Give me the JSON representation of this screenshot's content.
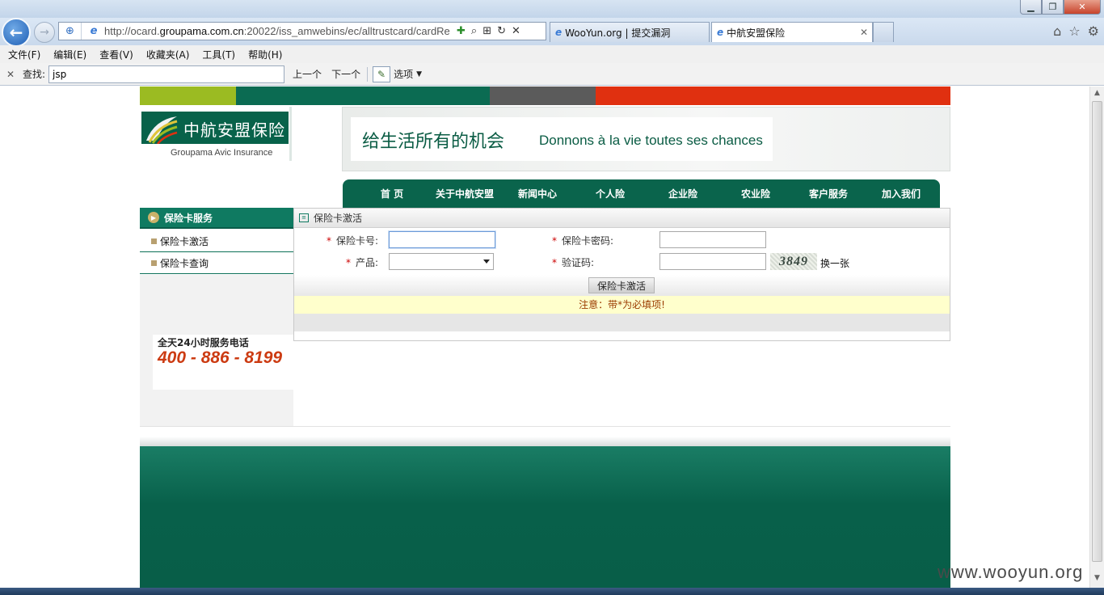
{
  "browser": {
    "url_prefix": "http://ocard.",
    "url_domain": "groupama.com.cn",
    "url_rest": ":20022/iss_amwebins/ec/alltrustcard/cardRe",
    "tabs": [
      {
        "label": "WooYun.org | 提交漏洞"
      },
      {
        "label": "中航安盟保险"
      }
    ],
    "menu": [
      "文件(F)",
      "编辑(E)",
      "查看(V)",
      "收藏夹(A)",
      "工具(T)",
      "帮助(H)"
    ],
    "find": {
      "label": "查找:",
      "value": "jsp",
      "prev": "上一个",
      "next": "下一个",
      "options": "选项"
    }
  },
  "site": {
    "colors": {
      "lime": "#9bbb22",
      "green": "#0b6b52",
      "gray": "#5b5b5b",
      "red": "#e03010"
    },
    "logo": {
      "cn": "中航安盟保险",
      "en": "Groupama Avic Insurance"
    },
    "slogan": {
      "cn": "给生活所有的机会",
      "fr": "Donnons à la vie toutes ses chances"
    },
    "nav": [
      "首 页",
      "关于中航安盟",
      "新闻中心",
      "个人险",
      "企业险",
      "农业险",
      "客户服务",
      "加入我们"
    ],
    "sidebar": {
      "title": "保险卡服务",
      "items": [
        {
          "label": "保险卡激活"
        },
        {
          "label": "保险卡查询"
        }
      ]
    },
    "hotline": {
      "title": "全天24小时服务电话",
      "number": "400 - 886 - 8199"
    },
    "form": {
      "title": "保险卡激活",
      "card_no_label": "保险卡号:",
      "password_label": "保险卡密码:",
      "product_label": "产品:",
      "captcha_label": "验证码:",
      "captcha_text": "3849",
      "refresh_label": "换一张",
      "submit_label": "保险卡激活",
      "notice": "注意：带*为必填项!"
    }
  },
  "watermark": "www.wooyun.org"
}
